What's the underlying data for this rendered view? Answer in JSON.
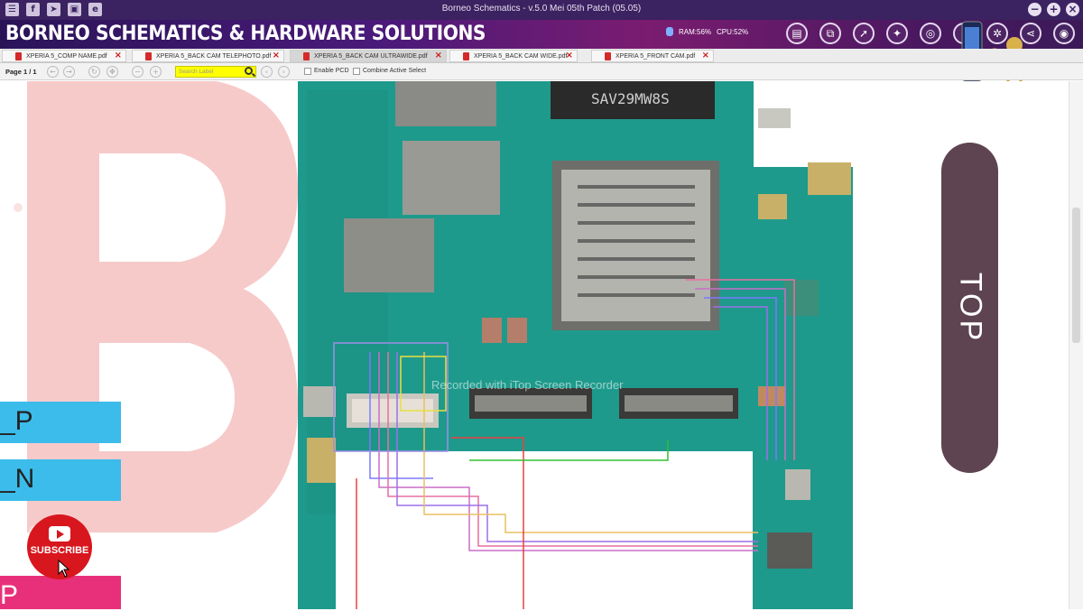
{
  "window": {
    "title": "Borneo Schematics - v.5.0 Mei 05th Patch (05.05)"
  },
  "brand": {
    "name": "BORNEO SCHEMATICS & HARDWARE SOLUTIONS",
    "ram": "RAM:56%",
    "cpu": "CPU:52%"
  },
  "tabs": [
    {
      "label": "XPERIA 5_COMP NAME.pdf",
      "active": false
    },
    {
      "label": "XPERIA 5_BACK CAM TELEPHOTO.pdf",
      "active": false
    },
    {
      "label": "XPERIA 5_BACK CAM ULTRAWIDE.pdf",
      "active": true
    },
    {
      "label": "XPERIA 5_BACK CAM WIDE.pdf",
      "active": false
    },
    {
      "label": "XPERIA 5_FRONT CAM.pdf",
      "active": false
    }
  ],
  "toolbar": {
    "page": "Page 1 / 1",
    "search_placeholder": "Search Label",
    "enable_pcd": "Enable PCD",
    "combine_select": "Combine Active Select"
  },
  "overlay": {
    "tag1": "_P",
    "tag2": "_N",
    "tag3": "P",
    "subscribe": "SUBSCRIBE",
    "top_label": "TOP",
    "watermark": "Recorded with iTop Screen Recorder",
    "chip_marking": "SAV29MW8S"
  },
  "colors": {
    "board": "#1e9a8c",
    "brand_purple": "#3b2260",
    "pill": "#5e4450"
  }
}
